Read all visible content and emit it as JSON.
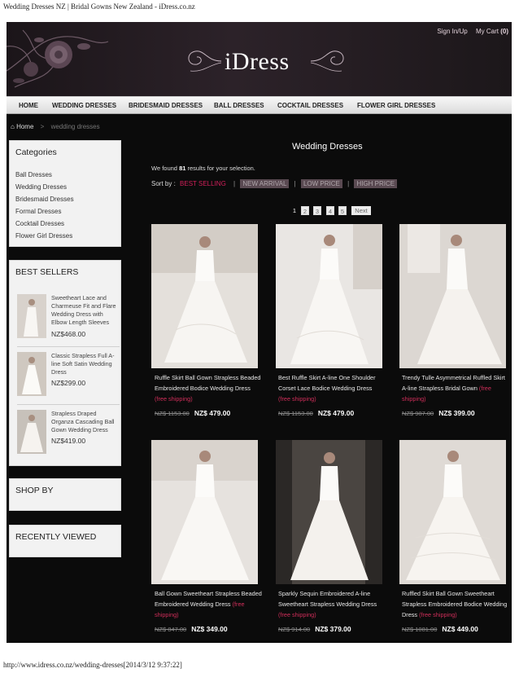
{
  "browser": {
    "page_title": "Wedding Dresses NZ | Bridal Gowns New Zealand - iDress.co.nz",
    "footer_url": "http://www.idress.co.nz/wedding-dresses[2014/3/12 9:37:22]"
  },
  "header": {
    "logo_text": "iDress",
    "sign_in": "Sign In/Up",
    "cart_label": "My Cart",
    "cart_count": "(0)"
  },
  "nav": {
    "items": [
      "HOME",
      "WEDDING DRESSES",
      "BRIDESMAID DRESSES",
      "BALL DRESSES",
      "COCKTAIL DRESSES",
      "FLOWER GIRL DRESSES"
    ]
  },
  "breadcrumb": {
    "home": "Home",
    "separator": ">",
    "current": "wedding dresses"
  },
  "sidebar": {
    "categories": {
      "title": "Categories",
      "items": [
        "Ball Dresses",
        "Wedding Dresses",
        "Bridesmaid Dresses",
        "Formal Dresses",
        "Cocktail Dresses",
        "Flower Girl Dresses"
      ]
    },
    "best_sellers": {
      "title": "BEST SELLERS",
      "items": [
        {
          "name": "Sweetheart Lace and Charmeuse Fit and Flare Wedding Dress with Elbow Length Sleeves",
          "price": "NZ$468.00"
        },
        {
          "name": "Classic Strapless Full A-line Soft Satin Wedding Dress",
          "price": "NZ$299.00"
        },
        {
          "name": "Strapless Draped Organza Cascading Ball Gown Wedding Dress",
          "price": "NZ$419.00"
        }
      ]
    },
    "shop_by": {
      "title": "SHOP BY"
    },
    "recently_viewed": {
      "title": "RECENTLY VIEWED"
    }
  },
  "main": {
    "title": "Wedding Dresses",
    "found_prefix": "We found",
    "found_count": "81",
    "found_suffix": "results for your selection.",
    "sort_label": "Sort by :",
    "sort_options": [
      "BEST SELLING",
      "NEW ARRIVAL",
      "LOW PRICE",
      "HIGH PRICE"
    ],
    "sort_separator": "|",
    "pagination": {
      "current": "1",
      "pages": [
        "2",
        "3",
        "4",
        "5"
      ],
      "next": "Next"
    },
    "products": [
      {
        "name": "Ruffle Skirt Ball Gown Strapless Beaded Embroidered Bodice Wedding Dress",
        "shipping": "(free shipping)",
        "old_price": "NZ$ 1153.00",
        "new_price": "NZ$ 479.00"
      },
      {
        "name": "Best Ruffle Skirt A-line One Shoulder Corset Lace Bodice Wedding Dress",
        "shipping": "(free shipping)",
        "old_price": "NZ$ 1153.00",
        "new_price": "NZ$ 479.00"
      },
      {
        "name": "Trendy Tulle Asymmetrical Ruffled Skirt A-line Strapless Bridal Gown",
        "shipping": "(free shipping)",
        "old_price": "NZ$ 987.00",
        "new_price": "NZ$ 399.00"
      },
      {
        "name": "Ball Gown Sweetheart Strapless Beaded Embroidered Wedding Dress",
        "shipping": "(free shipping)",
        "old_price": "NZ$ 847.00",
        "new_price": "NZ$ 349.00"
      },
      {
        "name": "Sparkly Sequin Embroidered A-line Sweetheart Strapless Wedding Dress",
        "shipping": "(free shipping)",
        "old_price": "NZ$ 914.00",
        "new_price": "NZ$ 379.00"
      },
      {
        "name": "Ruffled Skirt Ball Gown Sweetheart Strapless Embroidered Bodice Wedding Dress",
        "shipping": "(free shipping)",
        "old_price": "NZ$ 1081.00",
        "new_price": "NZ$ 449.00"
      }
    ]
  },
  "colors": {
    "accent": "#d21f5a",
    "page_bg": "#0b0b0b",
    "sidebar_bg": "#f2f2f2"
  }
}
